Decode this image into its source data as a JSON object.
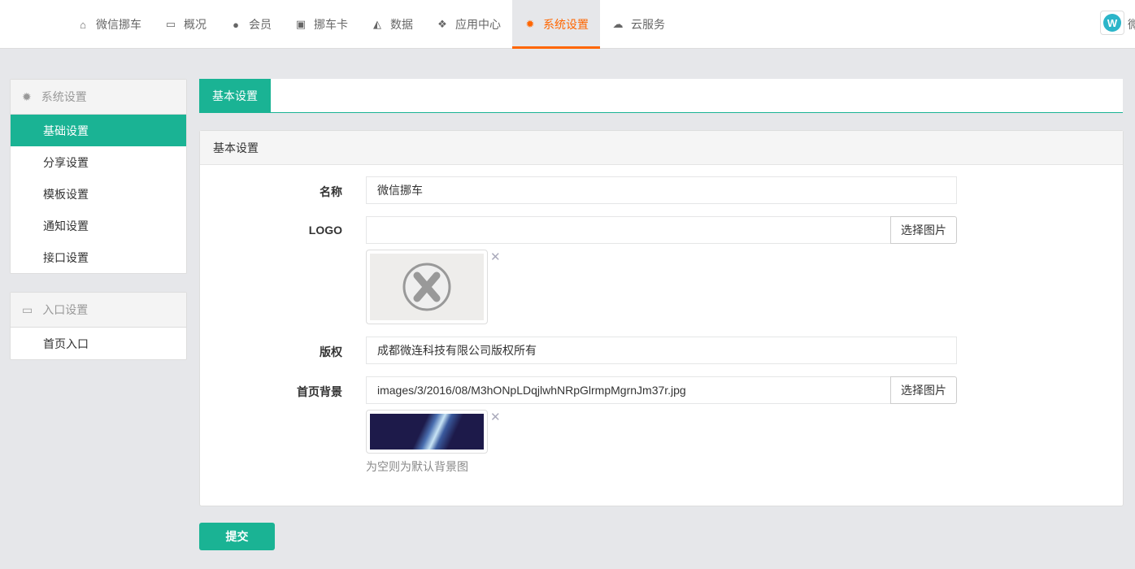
{
  "nav": {
    "items": [
      {
        "label": "微信挪车",
        "icon": "home-icon",
        "glyph": "⌂"
      },
      {
        "label": "概况",
        "icon": "monitor-icon",
        "glyph": "▭"
      },
      {
        "label": "会员",
        "icon": "user-icon",
        "glyph": "●"
      },
      {
        "label": "挪车卡",
        "icon": "gift-icon",
        "glyph": "▣"
      },
      {
        "label": "数据",
        "icon": "area-chart-icon",
        "glyph": "◭"
      },
      {
        "label": "应用中心",
        "icon": "cubes-icon",
        "glyph": "❖"
      },
      {
        "label": "系统设置",
        "icon": "gear-icon",
        "glyph": "✹"
      },
      {
        "label": "云服务",
        "icon": "cloud-icon",
        "glyph": "☁"
      }
    ],
    "active": 6,
    "logo_letter": "W",
    "user_text": "微"
  },
  "sidebar": {
    "group1": {
      "title": "系统设置",
      "items": [
        "基础设置",
        "分享设置",
        "模板设置",
        "通知设置",
        "接口设置"
      ]
    },
    "group2": {
      "title": "入口设置",
      "items": [
        "首页入口"
      ]
    }
  },
  "main": {
    "tab": "基本设置",
    "card_title": "基本设置",
    "fields": {
      "name_label": "名称",
      "name_value": "微信挪车",
      "logo_label": "LOGO",
      "logo_value": "",
      "choose": "选择图片",
      "copyright_label": "版权",
      "copyright_value": "成都微连科技有限公司版权所有",
      "bg_label": "首页背景",
      "bg_value": "images/3/2016/08/M3hONpLDqjlwhNRpGlrmpMgrnJm37r.jpg",
      "bg_help": "为空则为默认背景图"
    },
    "submit": "提交"
  },
  "colors": {
    "accent": "#1ab394",
    "active_nav": "#ff6600"
  }
}
